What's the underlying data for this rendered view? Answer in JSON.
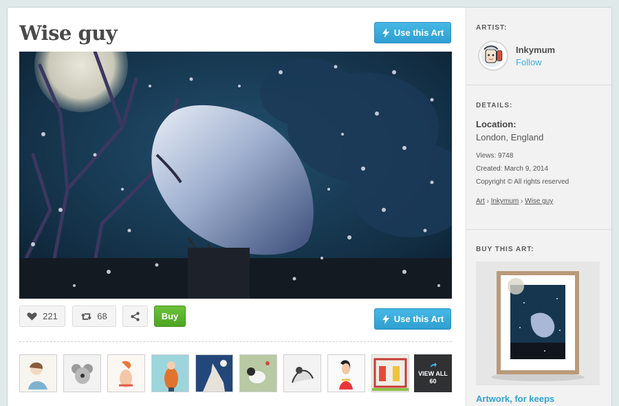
{
  "artwork": {
    "title": "Wise guy",
    "use_art_label": "Use this Art"
  },
  "actions": {
    "likes": "221",
    "reposts": "68",
    "buy_label": "Buy"
  },
  "thumbnails": {
    "view_all_label": "VIEW ALL",
    "view_all_count": "60"
  },
  "sidebar": {
    "artist_label": "ARTIST:",
    "artist_name": "Inkymum",
    "follow_label": "Follow",
    "details_label": "DETAILS:",
    "location_label": "Location:",
    "location_value": "London, England",
    "views": "Views: 9748",
    "created": "Created: March 9, 2014",
    "copyright": "Copyright © All rights reserved",
    "breadcrumb": [
      "Art",
      "Inkymum",
      "Wise guy"
    ],
    "breadcrumb_sep": "›",
    "buy_label": "BUY THIS ART:",
    "buy_link": "Artwork, for keeps"
  },
  "colors": {
    "accent_blue": "#3bb0de",
    "buy_green": "#5cb22f",
    "night_sky": "#16364f"
  }
}
